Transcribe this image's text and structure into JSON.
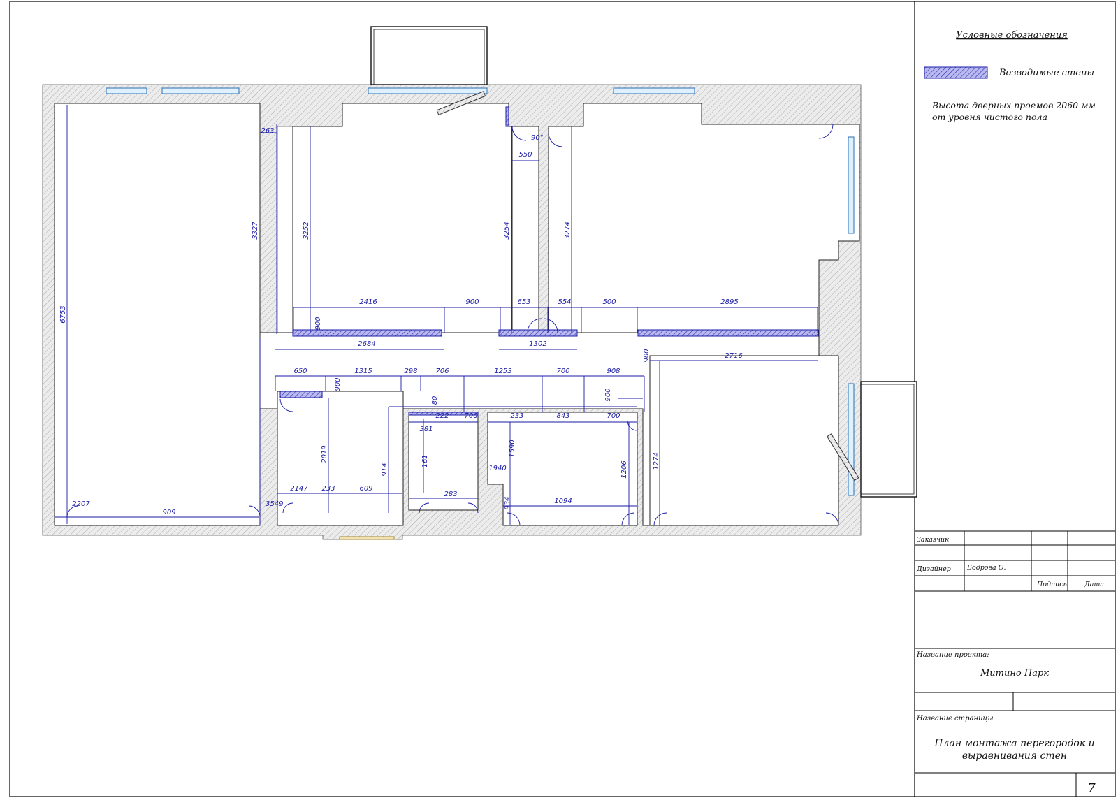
{
  "legend": {
    "title": "Условные обозначения",
    "new_walls_label": "Возводимые стены",
    "door_note_line1": "Высота дверных проемов 2060 мм",
    "door_note_line2": "от уровня чистого пола"
  },
  "title_block": {
    "customer_label": "Заказчик",
    "designer_label": "Дизайнер",
    "designer_name": "Бодрова О.",
    "signature_label": "Подпись",
    "date_label": "Дата",
    "project_label": "Название проекта:",
    "project_name": "Митино Парк",
    "page_label": "Название страницы",
    "page_title_line1": "План монтажа перегородок и",
    "page_title_line2": "выравнивания стен",
    "sheet_number": "7"
  },
  "dimensions": [
    "6753",
    "3327",
    "263",
    "3252",
    "550",
    "3254",
    "3274",
    "2416",
    "900",
    "653",
    "554",
    "500",
    "2895",
    "900",
    "2684",
    "1302",
    "900",
    "2716",
    "650",
    "1315",
    "298",
    "706",
    "1253",
    "700",
    "908",
    "900",
    "80",
    "900",
    "222",
    "706",
    "233",
    "843",
    "700",
    "381",
    "161",
    "1590",
    "1206",
    "1274",
    "2019",
    "914",
    "1940",
    "2147",
    "233",
    "609",
    "283",
    "934",
    "1094",
    "909",
    "2207",
    "3549",
    "90°"
  ],
  "colors": {
    "line": "#1a1aa6",
    "wall_hatch": "#d9d9d9",
    "new_wall": "#7d7de0",
    "window": "#5aa8e0"
  }
}
